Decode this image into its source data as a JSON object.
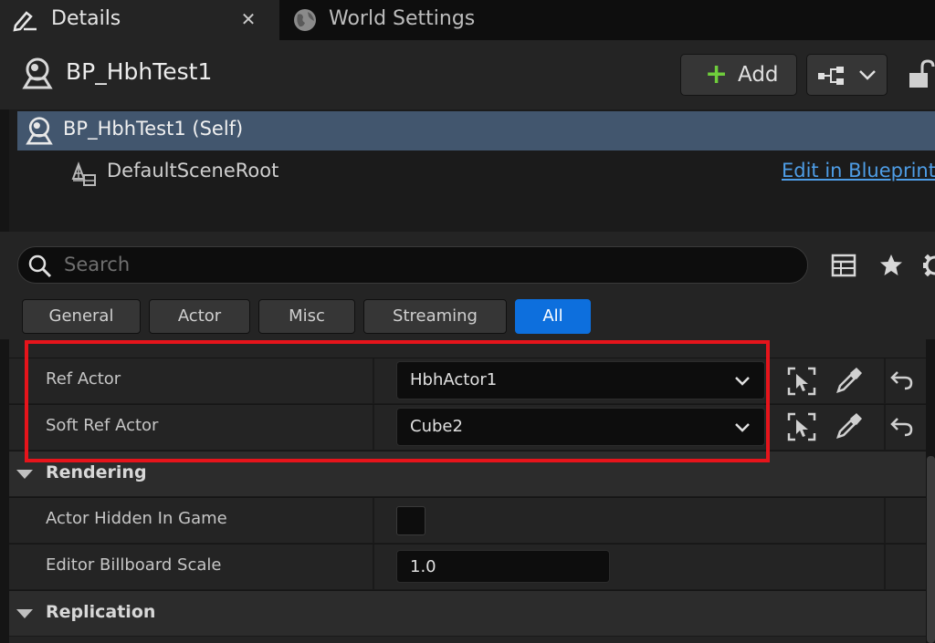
{
  "tabs": [
    {
      "label": "Details",
      "icon": "pencil-icon",
      "active": true
    },
    {
      "label": "World Settings",
      "icon": "globe-icon",
      "active": false
    }
  ],
  "header": {
    "actor_name": "BP_HbhTest1",
    "add_label": "Add"
  },
  "tree": {
    "self_label": "BP_HbhTest1 (Self)",
    "root_label": "DefaultSceneRoot",
    "edit_link": "Edit in Blueprint"
  },
  "search": {
    "placeholder": "Search"
  },
  "categories": [
    "General",
    "Actor",
    "Misc",
    "Streaming",
    "All"
  ],
  "active_category": "All",
  "properties": {
    "ref_actor": {
      "label": "Ref Actor",
      "value": "HbhActor1"
    },
    "soft_ref_actor": {
      "label": "Soft Ref Actor",
      "value": "Cube2"
    },
    "rendering": {
      "label": "Rendering"
    },
    "actor_hidden": {
      "label": "Actor Hidden In Game",
      "checked": false
    },
    "billboard_scale": {
      "label": "Editor Billboard Scale",
      "value": "1.0"
    },
    "replication": {
      "label": "Replication"
    }
  },
  "colors": {
    "accent": "#0d6fdd",
    "selection": "#42566e",
    "add_plus": "#6fcd3c",
    "highlight": "#e6141b",
    "link": "#4e9de6"
  }
}
